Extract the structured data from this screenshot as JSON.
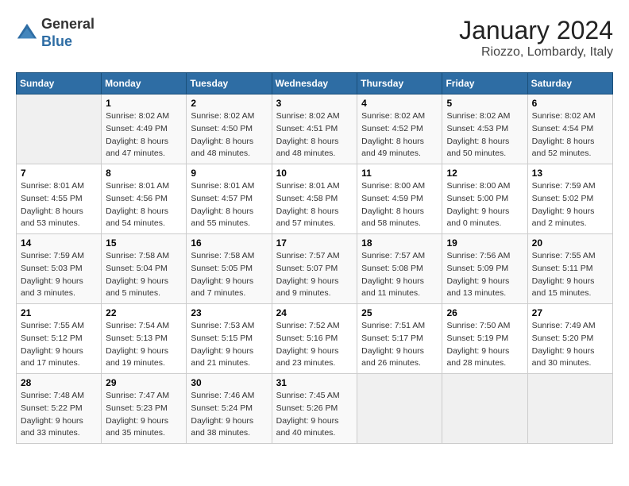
{
  "header": {
    "logo": {
      "line1": "General",
      "line2": "Blue"
    },
    "title": "January 2024",
    "subtitle": "Riozzo, Lombardy, Italy"
  },
  "days_of_week": [
    "Sunday",
    "Monday",
    "Tuesday",
    "Wednesday",
    "Thursday",
    "Friday",
    "Saturday"
  ],
  "weeks": [
    [
      {
        "day": null
      },
      {
        "day": 1,
        "sunrise": "Sunrise: 8:02 AM",
        "sunset": "Sunset: 4:49 PM",
        "daylight": "Daylight: 8 hours and 47 minutes."
      },
      {
        "day": 2,
        "sunrise": "Sunrise: 8:02 AM",
        "sunset": "Sunset: 4:50 PM",
        "daylight": "Daylight: 8 hours and 48 minutes."
      },
      {
        "day": 3,
        "sunrise": "Sunrise: 8:02 AM",
        "sunset": "Sunset: 4:51 PM",
        "daylight": "Daylight: 8 hours and 48 minutes."
      },
      {
        "day": 4,
        "sunrise": "Sunrise: 8:02 AM",
        "sunset": "Sunset: 4:52 PM",
        "daylight": "Daylight: 8 hours and 49 minutes."
      },
      {
        "day": 5,
        "sunrise": "Sunrise: 8:02 AM",
        "sunset": "Sunset: 4:53 PM",
        "daylight": "Daylight: 8 hours and 50 minutes."
      },
      {
        "day": 6,
        "sunrise": "Sunrise: 8:02 AM",
        "sunset": "Sunset: 4:54 PM",
        "daylight": "Daylight: 8 hours and 52 minutes."
      }
    ],
    [
      {
        "day": 7,
        "sunrise": "Sunrise: 8:01 AM",
        "sunset": "Sunset: 4:55 PM",
        "daylight": "Daylight: 8 hours and 53 minutes."
      },
      {
        "day": 8,
        "sunrise": "Sunrise: 8:01 AM",
        "sunset": "Sunset: 4:56 PM",
        "daylight": "Daylight: 8 hours and 54 minutes."
      },
      {
        "day": 9,
        "sunrise": "Sunrise: 8:01 AM",
        "sunset": "Sunset: 4:57 PM",
        "daylight": "Daylight: 8 hours and 55 minutes."
      },
      {
        "day": 10,
        "sunrise": "Sunrise: 8:01 AM",
        "sunset": "Sunset: 4:58 PM",
        "daylight": "Daylight: 8 hours and 57 minutes."
      },
      {
        "day": 11,
        "sunrise": "Sunrise: 8:00 AM",
        "sunset": "Sunset: 4:59 PM",
        "daylight": "Daylight: 8 hours and 58 minutes."
      },
      {
        "day": 12,
        "sunrise": "Sunrise: 8:00 AM",
        "sunset": "Sunset: 5:00 PM",
        "daylight": "Daylight: 9 hours and 0 minutes."
      },
      {
        "day": 13,
        "sunrise": "Sunrise: 7:59 AM",
        "sunset": "Sunset: 5:02 PM",
        "daylight": "Daylight: 9 hours and 2 minutes."
      }
    ],
    [
      {
        "day": 14,
        "sunrise": "Sunrise: 7:59 AM",
        "sunset": "Sunset: 5:03 PM",
        "daylight": "Daylight: 9 hours and 3 minutes."
      },
      {
        "day": 15,
        "sunrise": "Sunrise: 7:58 AM",
        "sunset": "Sunset: 5:04 PM",
        "daylight": "Daylight: 9 hours and 5 minutes."
      },
      {
        "day": 16,
        "sunrise": "Sunrise: 7:58 AM",
        "sunset": "Sunset: 5:05 PM",
        "daylight": "Daylight: 9 hours and 7 minutes."
      },
      {
        "day": 17,
        "sunrise": "Sunrise: 7:57 AM",
        "sunset": "Sunset: 5:07 PM",
        "daylight": "Daylight: 9 hours and 9 minutes."
      },
      {
        "day": 18,
        "sunrise": "Sunrise: 7:57 AM",
        "sunset": "Sunset: 5:08 PM",
        "daylight": "Daylight: 9 hours and 11 minutes."
      },
      {
        "day": 19,
        "sunrise": "Sunrise: 7:56 AM",
        "sunset": "Sunset: 5:09 PM",
        "daylight": "Daylight: 9 hours and 13 minutes."
      },
      {
        "day": 20,
        "sunrise": "Sunrise: 7:55 AM",
        "sunset": "Sunset: 5:11 PM",
        "daylight": "Daylight: 9 hours and 15 minutes."
      }
    ],
    [
      {
        "day": 21,
        "sunrise": "Sunrise: 7:55 AM",
        "sunset": "Sunset: 5:12 PM",
        "daylight": "Daylight: 9 hours and 17 minutes."
      },
      {
        "day": 22,
        "sunrise": "Sunrise: 7:54 AM",
        "sunset": "Sunset: 5:13 PM",
        "daylight": "Daylight: 9 hours and 19 minutes."
      },
      {
        "day": 23,
        "sunrise": "Sunrise: 7:53 AM",
        "sunset": "Sunset: 5:15 PM",
        "daylight": "Daylight: 9 hours and 21 minutes."
      },
      {
        "day": 24,
        "sunrise": "Sunrise: 7:52 AM",
        "sunset": "Sunset: 5:16 PM",
        "daylight": "Daylight: 9 hours and 23 minutes."
      },
      {
        "day": 25,
        "sunrise": "Sunrise: 7:51 AM",
        "sunset": "Sunset: 5:17 PM",
        "daylight": "Daylight: 9 hours and 26 minutes."
      },
      {
        "day": 26,
        "sunrise": "Sunrise: 7:50 AM",
        "sunset": "Sunset: 5:19 PM",
        "daylight": "Daylight: 9 hours and 28 minutes."
      },
      {
        "day": 27,
        "sunrise": "Sunrise: 7:49 AM",
        "sunset": "Sunset: 5:20 PM",
        "daylight": "Daylight: 9 hours and 30 minutes."
      }
    ],
    [
      {
        "day": 28,
        "sunrise": "Sunrise: 7:48 AM",
        "sunset": "Sunset: 5:22 PM",
        "daylight": "Daylight: 9 hours and 33 minutes."
      },
      {
        "day": 29,
        "sunrise": "Sunrise: 7:47 AM",
        "sunset": "Sunset: 5:23 PM",
        "daylight": "Daylight: 9 hours and 35 minutes."
      },
      {
        "day": 30,
        "sunrise": "Sunrise: 7:46 AM",
        "sunset": "Sunset: 5:24 PM",
        "daylight": "Daylight: 9 hours and 38 minutes."
      },
      {
        "day": 31,
        "sunrise": "Sunrise: 7:45 AM",
        "sunset": "Sunset: 5:26 PM",
        "daylight": "Daylight: 9 hours and 40 minutes."
      },
      {
        "day": null
      },
      {
        "day": null
      },
      {
        "day": null
      }
    ]
  ]
}
